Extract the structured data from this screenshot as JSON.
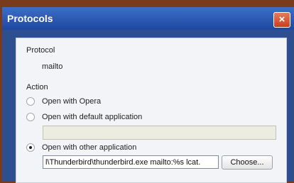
{
  "window": {
    "title": "Protocols",
    "close_glyph": "×"
  },
  "protocol": {
    "heading": "Protocol",
    "value": "mailto"
  },
  "action": {
    "heading": "Action",
    "options": [
      {
        "label": "Open with Opera",
        "checked": false
      },
      {
        "label": "Open with default application",
        "checked": false
      },
      {
        "label": "Open with other application",
        "checked": true
      }
    ],
    "default_application_value": "",
    "other_application_path": "l\\Thunderbird\\thunderbird.exe mailto:%s lcat.",
    "choose_label": "Choose..."
  },
  "colors": {
    "titlebar": "#2b5ab8",
    "close_button": "#d9543a",
    "panel": "#f3f4f7"
  },
  "icons": {
    "close": "close-icon",
    "radio": "radio-button-icon"
  }
}
